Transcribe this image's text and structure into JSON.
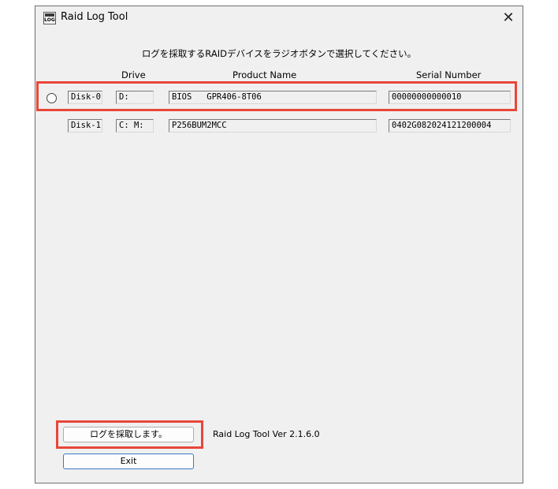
{
  "window": {
    "title": "Raid Log Tool",
    "icon_text": "LOG",
    "close_glyph": "✕"
  },
  "instruction": "ログを採取するRAIDデバイスをラジオボタンで選択してください。",
  "columns": {
    "drive": "Drive",
    "product": "Product Name",
    "serial": "Serial Number"
  },
  "devices": [
    {
      "disk": "Disk-0",
      "drive": "D:",
      "product": "BIOS   GPR406-8T06",
      "serial": "00000000000010",
      "has_radio": true,
      "selected": false
    },
    {
      "disk": "Disk-1",
      "drive": "C: M:",
      "product": "P256BUM2MCC",
      "serial": "0402G082024121200004",
      "has_radio": false
    }
  ],
  "buttons": {
    "collect": "ログを採取します。",
    "exit": "Exit"
  },
  "version": "Raid Log Tool Ver 2.1.6.0",
  "colors": {
    "window_bg": "#f0f0f0",
    "highlight": "#e8473a",
    "exit_border": "#3c78c8"
  }
}
